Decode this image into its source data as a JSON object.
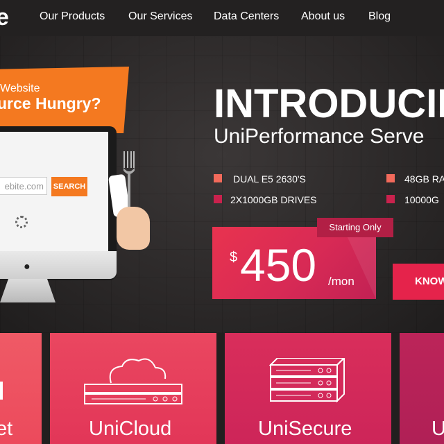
{
  "header": {
    "logo_text": "e",
    "nav": [
      "Our Products",
      "Our Services",
      "Data Centers",
      "About us",
      "Blog"
    ]
  },
  "promo": {
    "line1": "Website",
    "line2": "urce Hungry?",
    "search_placeholder": "ebite.com",
    "search_button": "SEARCH"
  },
  "hero": {
    "title": "INTRODUCIN",
    "subtitle": "UniPerformance Serve",
    "specs": [
      {
        "label": "DUAL E5 2630'S",
        "color": "#f26a5b"
      },
      {
        "label": "48GB RA",
        "color": "#f26a5b"
      },
      {
        "label": "2X1000GB DRIVES",
        "color": "#c9224d"
      },
      {
        "label": "10000G",
        "color": "#c9224d"
      }
    ],
    "price_tag": "Starting Only",
    "currency": "$",
    "price": "450",
    "price_unit": "/mon",
    "cta": "KNOW"
  },
  "products": [
    {
      "title": "et",
      "color": "#ef4f62"
    },
    {
      "title": "UniCloud",
      "color": "#e73c5b"
    },
    {
      "title": "UniSecure",
      "color": "#d82a5a"
    },
    {
      "title": "U",
      "color": "#b52258"
    }
  ]
}
